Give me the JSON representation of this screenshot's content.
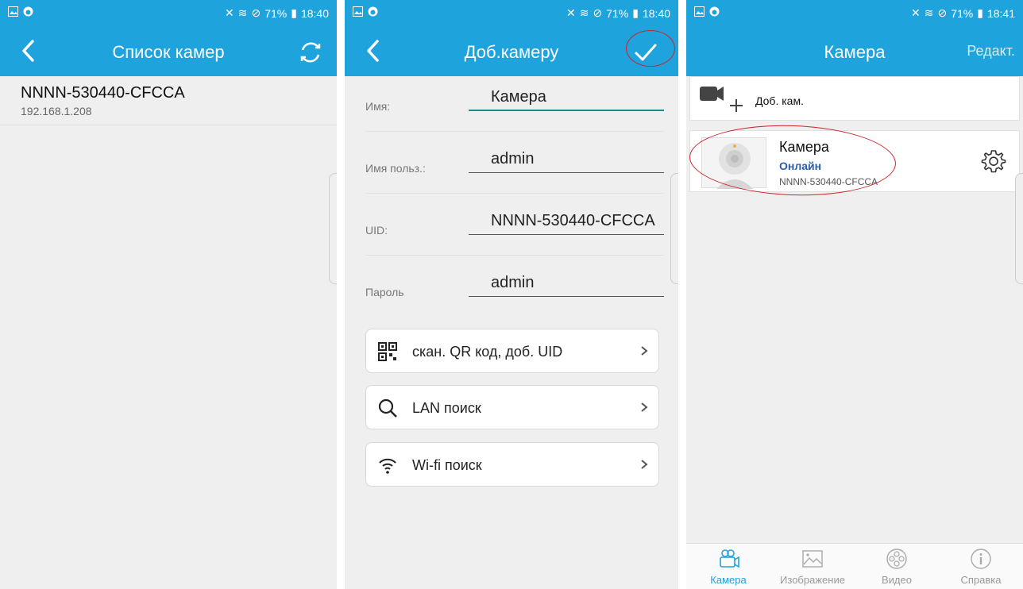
{
  "colors": {
    "accent": "#1ea3dd",
    "annotation": "#c8252c",
    "online": "#2a5ea8"
  },
  "screen1": {
    "status": {
      "battery": "71%",
      "time": "18:40"
    },
    "nav": {
      "title": "Список камер",
      "back_icon": "back-chevron-icon",
      "right_icon": "refresh-icon"
    },
    "camera": {
      "name": "NNNN-530440-CFCCA",
      "ip": "192.168.1.208"
    }
  },
  "screen2": {
    "status": {
      "battery": "71%",
      "time": "18:40"
    },
    "nav": {
      "title": "Доб.камеру",
      "back_icon": "back-chevron-icon",
      "right_icon": "checkmark-icon"
    },
    "fields": [
      {
        "label": "Имя:",
        "value": "Камера"
      },
      {
        "label": "Имя польз.:",
        "value": "admin"
      },
      {
        "label": "UID:",
        "value": "NNNN-530440-CFCCA"
      },
      {
        "label": "Пароль",
        "value": "admin"
      }
    ],
    "buttons": [
      {
        "label": "скан. QR код, доб. UID",
        "icon": "qr-code-icon"
      },
      {
        "label": "LAN поиск",
        "icon": "search-icon"
      },
      {
        "label": "Wi-fi поиск",
        "icon": "wifi-icon"
      }
    ]
  },
  "screen3": {
    "status": {
      "battery": "71%",
      "time": "18:41"
    },
    "nav": {
      "title": "Камера",
      "right_label": "Редакт."
    },
    "add_camera": {
      "label": "Доб. кам.",
      "icon": "add-camera-icon"
    },
    "camera_card": {
      "name": "Камера",
      "status": "Онлайн",
      "uid": "NNNN-530440-CFCCA"
    },
    "tabs": [
      {
        "label": "Камера",
        "icon": "camera-tab-icon",
        "active": true
      },
      {
        "label": "Изображение",
        "icon": "image-tab-icon",
        "active": false
      },
      {
        "label": "Видео",
        "icon": "video-reel-icon",
        "active": false
      },
      {
        "label": "Справка",
        "icon": "info-icon",
        "active": false
      }
    ]
  }
}
